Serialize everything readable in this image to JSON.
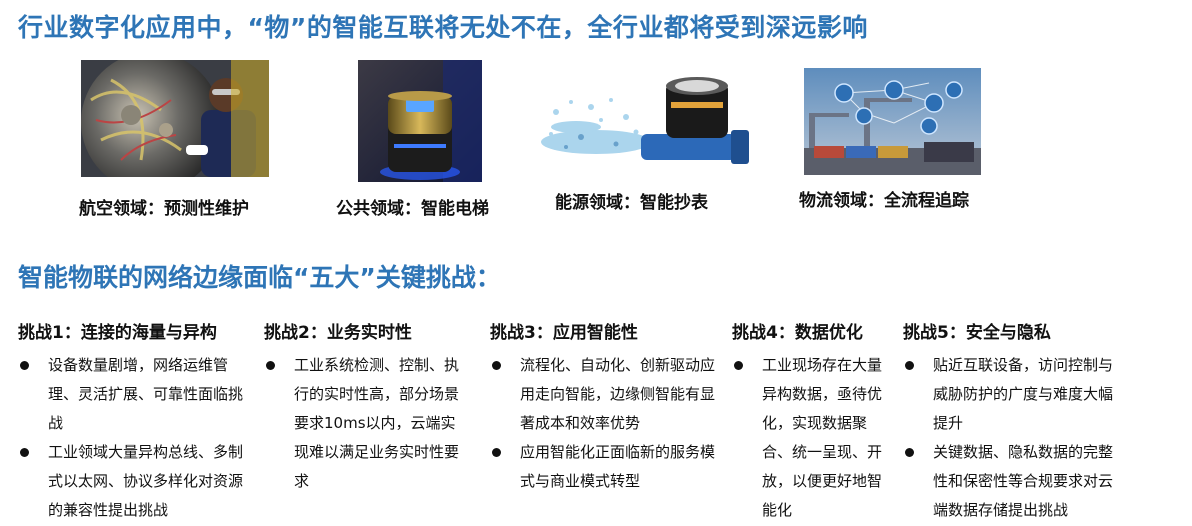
{
  "headline": "行业数字化应用中，“物”的智能互联将无处不在，全行业都将受到深远影响",
  "images": [
    {
      "caption": "航空领域：预测性维护",
      "icon": "aviation-maintenance-photo"
    },
    {
      "caption": "公共领域：智能电梯",
      "icon": "smart-elevator-photo"
    },
    {
      "caption": "能源领域：智能抄表",
      "icon": "water-meter-photo"
    },
    {
      "caption": "物流领域：全流程追踪",
      "icon": "logistics-tracking-photo"
    }
  ],
  "section_title": "智能物联的网络边缘面临“五大”关键挑战：",
  "challenges": [
    {
      "title": "挑战1：连接的海量与异构",
      "bullets": [
        "设备数量剧增，网络运维管理、灵活扩展、可靠性面临挑战",
        "工业领域大量异构总线、多制式以太网、协议多样化对资源的兼容性提出挑战"
      ]
    },
    {
      "title": "挑战2：业务实时性",
      "bullets": [
        "工业系统检测、控制、执行的实时性高，部分场景要求10ms以内，云端实现难以满足业务实时性要求"
      ]
    },
    {
      "title": "挑战3：应用智能性",
      "bullets": [
        "流程化、自动化、创新驱动应用走向智能，边缘侧智能有显著成本和效率优势",
        "应用智能化正面临新的服务模式与商业模式转型"
      ]
    },
    {
      "title": "挑战4：数据优化",
      "bullets": [
        "工业现场存在大量异构数据，亟待优化，实现数据聚合、统一呈现、开放，以便更好地智能化"
      ]
    },
    {
      "title": "挑战5：安全与隐私",
      "bullets": [
        "贴近互联设备，访问控制与威胁防护的广度与难度大幅提升",
        "关键数据、隐私数据的完整性和保密性等合规要求对云端数据存储提出挑战"
      ]
    }
  ],
  "colors": {
    "accent": "#2e75b6",
    "text": "#111111"
  }
}
